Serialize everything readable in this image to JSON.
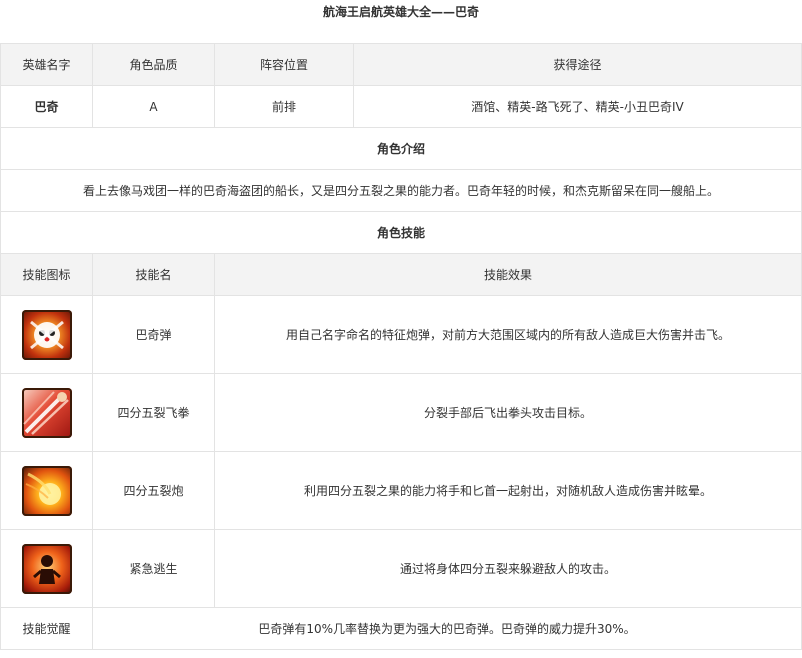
{
  "page_title": "航海王启航英雄大全——巴奇",
  "info_headers": [
    "英雄名字",
    "角色品质",
    "阵容位置",
    "获得途径"
  ],
  "info_row": {
    "name": "巴奇",
    "quality": "A",
    "position": "前排",
    "source": "酒馆、精英-路飞死了、精英-小丑巴奇IV"
  },
  "intro_title": "角色介绍",
  "intro_text": "看上去像马戏团一样的巴奇海盗团的船长，又是四分五裂之果的能力者。巴奇年轻的时候，和杰克斯留呆在同一艘船上。",
  "skills_title": "角色技能",
  "skill_headers": [
    "技能图标",
    "技能名",
    "技能效果"
  ],
  "skills": [
    {
      "icon": "buggy-cannon-skull-icon",
      "name": "巴奇弹",
      "effect": "用自己名字命名的特征炮弹，对前方大范围区域内的所有敌人造成巨大伤害并击飞。"
    },
    {
      "icon": "flying-fist-slash-icon",
      "name": "四分五裂飞拳",
      "effect": "分裂手部后飞出拳头攻击目标。"
    },
    {
      "icon": "fireball-cannon-icon",
      "name": "四分五裂炮",
      "effect": "利用四分五裂之果的能力将手和匕首一起射出，对随机敌人造成伤害并眩晕。"
    },
    {
      "icon": "escape-figure-flame-icon",
      "name": "紧急逃生",
      "effect": "通过将身体四分五裂来躲避敌人的攻击。"
    }
  ],
  "awaken": {
    "label": "技能觉醒",
    "text": "巴奇弹有10%几率替换为更为强大的巴奇弹。巴奇弹的威力提升30%。"
  }
}
